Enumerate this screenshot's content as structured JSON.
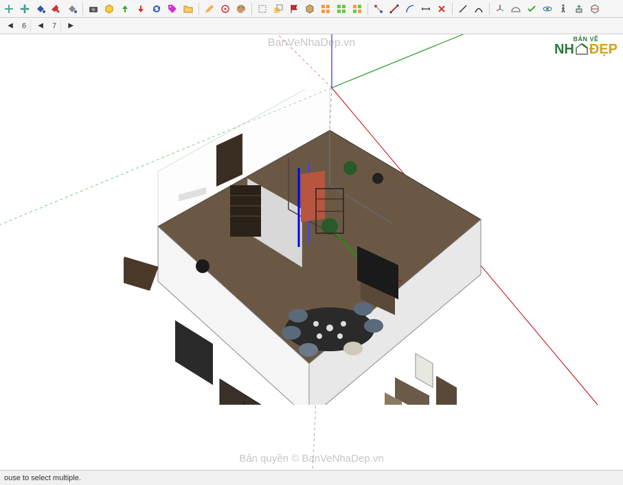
{
  "toolbar": {
    "tabs": [
      "6",
      "7"
    ]
  },
  "watermarks": {
    "top": "BanVeNhaDep.vn",
    "bottom": "Bản quyền © BanVeNhaDep.vn",
    "logo_top": "BẢN VẼ",
    "logo_nh": "NH",
    "logo_dep": "ĐẸP"
  },
  "status": {
    "hint": "ouse to select multiple."
  },
  "axes": {
    "red": "#d40000",
    "green": "#00a000",
    "blue": "#0000d4"
  }
}
